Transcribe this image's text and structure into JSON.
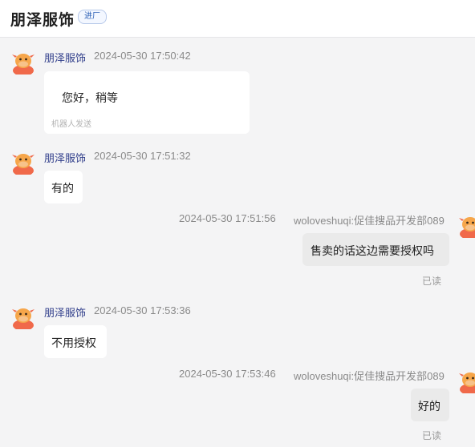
{
  "header": {
    "title": "朋泽服饰",
    "badge": "进厂"
  },
  "messages": [
    {
      "sender": "朋泽服饰",
      "time": "2024-05-30 17:50:42",
      "text": "您好，稍等",
      "note": "机器人发送"
    },
    {
      "sender": "朋泽服饰",
      "time": "2024-05-30 17:51:32",
      "text": "有的"
    },
    {
      "sender": "woloveshuqi:促佳搜品开发部089",
      "time": "2024-05-30 17:51:56",
      "text": "售卖的话这边需要授权吗",
      "status": "已读"
    },
    {
      "sender": "朋泽服饰",
      "time": "2024-05-30 17:53:36",
      "text": "不用授权"
    },
    {
      "sender": "woloveshuqi:促佳搜品开发部089",
      "time": "2024-05-30 17:53:46",
      "text": "好的",
      "status": "已读"
    }
  ],
  "colors": {
    "avatar_face": "#f6a64a",
    "avatar_body": "#f0694a",
    "sender_name": "#2f3d8a"
  },
  "icons": {
    "avatar": "cartoon-cow-avatar-icon"
  }
}
